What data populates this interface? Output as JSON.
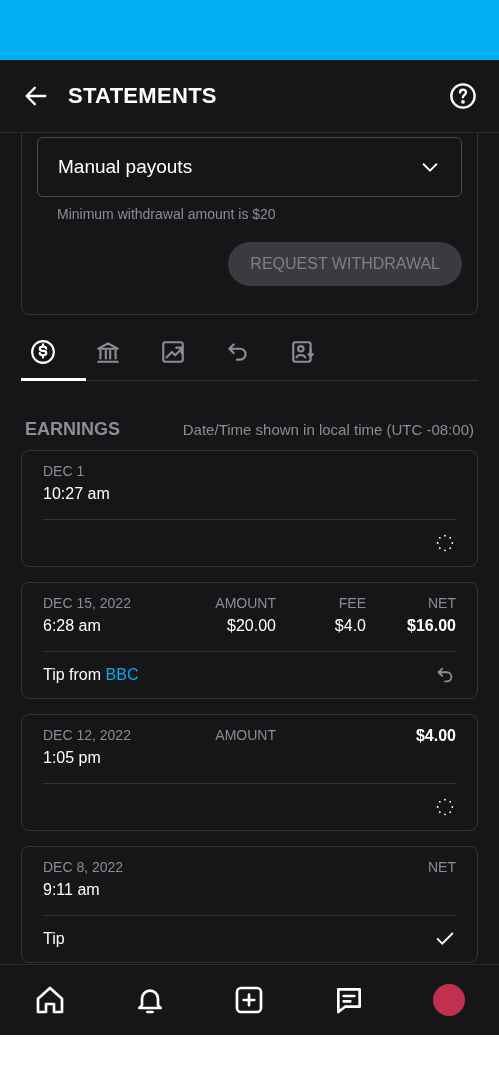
{
  "header": {
    "title": "STATEMENTS"
  },
  "payout": {
    "method": "Manual payouts",
    "hint": "Minimum withdrawal amount is $20",
    "button": {
      "label": "REQUEST WITHDRAWAL",
      "disabled": true
    }
  },
  "tabs": [
    {
      "selected": true
    },
    {
      "selected": false
    },
    {
      "selected": false
    },
    {
      "selected": false
    },
    {
      "selected": false
    }
  ],
  "earnings": {
    "title": "EARNINGS",
    "timezone_note": "Date/Time shown in local time (UTC -08:00)"
  },
  "transactions": [
    {
      "date": "DEC 1",
      "time": "10:27 am",
      "kind": "pending"
    },
    {
      "date": "DEC 15, 2022",
      "time": "6:28 am",
      "amount_label": "AMOUNT",
      "amount": "$20.00",
      "fee_label": "FEE",
      "fee": "$4.0",
      "net_label": "NET",
      "net": "$16.00",
      "description": "Tip from ",
      "from": "BBC",
      "kind": "reversed"
    },
    {
      "date": "DEC 12, 2022",
      "time": "1:05 pm",
      "amount_label": "AMOUNT",
      "net": "$4.00",
      "kind": "pending"
    },
    {
      "date": "DEC 8, 2022",
      "time": "9:11 am",
      "net_label": "NET",
      "description": "Tip",
      "kind": "done"
    }
  ],
  "bottom_nav": [
    {
      "selected": false
    },
    {
      "selected": false
    },
    {
      "selected": false
    },
    {
      "selected": false
    },
    {
      "selected": false
    }
  ]
}
